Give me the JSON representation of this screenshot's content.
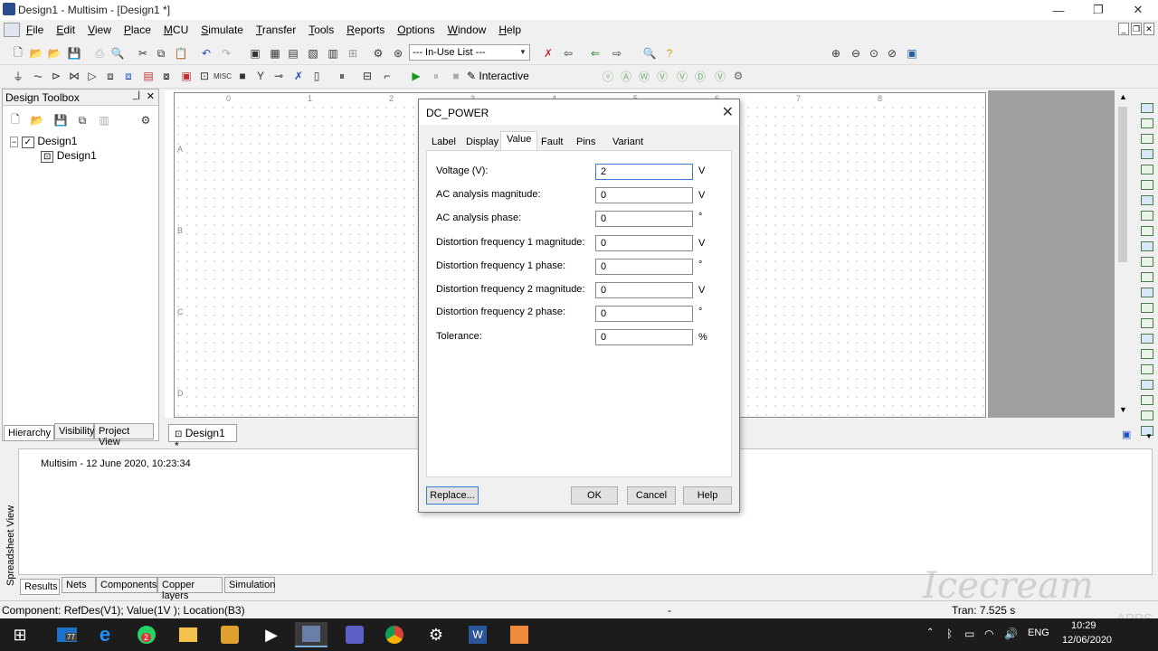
{
  "window": {
    "title": "Design1 - Multisim - [Design1 *]",
    "min": "—",
    "restore": "❐",
    "close": "✕"
  },
  "menu": [
    "File",
    "Edit",
    "View",
    "Place",
    "MCU",
    "Simulate",
    "Transfer",
    "Tools",
    "Reports",
    "Options",
    "Window",
    "Help"
  ],
  "toolbar": {
    "inuse_list": "--- In-Use List ---",
    "interactive_label": "Interactive"
  },
  "toolbox": {
    "title": "Design Toolbox",
    "tree_root": "Design1",
    "tree_child": "Design1",
    "tabs": [
      "Hierarchy",
      "Visibility",
      "Project View"
    ]
  },
  "canvas": {
    "col_labels": [
      "0",
      "1",
      "2",
      "3",
      "4",
      "5",
      "6",
      "7",
      "8"
    ],
    "row_labels": [
      "A",
      "B",
      "C",
      "D"
    ]
  },
  "doc_tab": "Design1 *",
  "output": {
    "log_line": "Multisim  -  12 June 2020, 10:23:34",
    "side_label": "Spreadsheet View"
  },
  "bottom_tabs": [
    "Results",
    "Nets",
    "Components",
    "Copper layers",
    "Simulation"
  ],
  "status": {
    "left": "Component: RefDes(V1); Value(1V ); Location(B3)",
    "mid": "-",
    "right": "Tran: 7.525 s"
  },
  "taskbar": {
    "time": "10:29",
    "date": "12/06/2020",
    "lang": "ENG",
    "badge_outlook": "77",
    "badge_whatsapp": "2"
  },
  "watermark": "Icecream APPS",
  "dialog": {
    "title": "DC_POWER",
    "tabs": [
      "Label",
      "Display",
      "Value",
      "Fault",
      "Pins",
      "Variant"
    ],
    "active_tab": "Value",
    "fields": [
      {
        "label": "Voltage (V):",
        "value": "2",
        "unit": "V"
      },
      {
        "label": "AC analysis magnitude:",
        "value": "0",
        "unit": "V"
      },
      {
        "label": "AC analysis phase:",
        "value": "0",
        "unit": "°"
      },
      {
        "label": "Distortion frequency 1 magnitude:",
        "value": "0",
        "unit": "V"
      },
      {
        "label": "Distortion frequency 1 phase:",
        "value": "0",
        "unit": "°"
      },
      {
        "label": "Distortion frequency 2 magnitude:",
        "value": "0",
        "unit": "V"
      },
      {
        "label": "Distortion frequency 2 phase:",
        "value": "0",
        "unit": "°"
      },
      {
        "label": "Tolerance:",
        "value": "0",
        "unit": "%"
      }
    ],
    "buttons": {
      "replace": "Replace...",
      "ok": "OK",
      "cancel": "Cancel",
      "help": "Help"
    }
  },
  "colors": {
    "accent": "#3a7bd5",
    "taskbar": "#1c1c1c",
    "canvas_gray": "#a0a0a0"
  }
}
